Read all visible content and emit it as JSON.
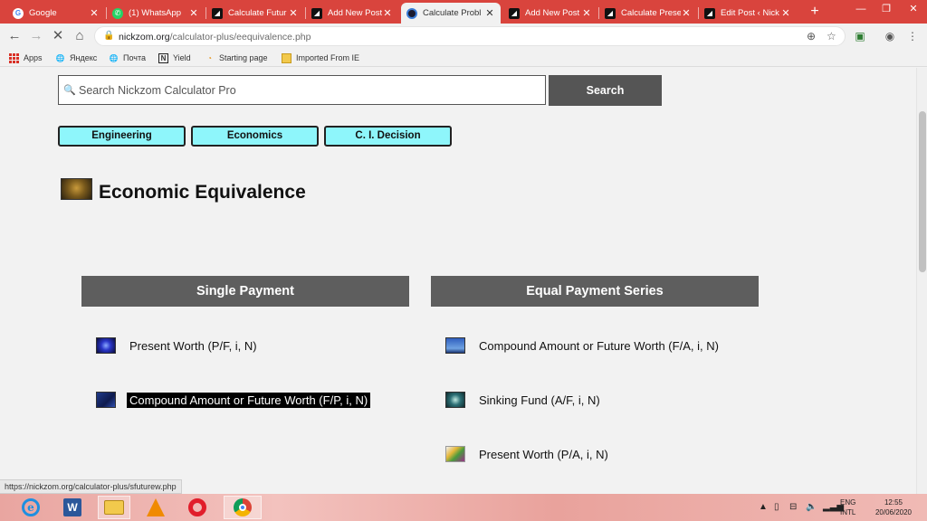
{
  "browser": {
    "tabs": [
      {
        "title": "Google",
        "favicon": "google-icon",
        "active": false
      },
      {
        "title": "(1) WhatsApp",
        "favicon": "whatsapp-icon",
        "active": false
      },
      {
        "title": "Calculate Futur",
        "favicon": "nickzom-icon",
        "active": false
      },
      {
        "title": "Add New Post",
        "favicon": "nickzom-icon",
        "active": false
      },
      {
        "title": "Calculate Probl",
        "favicon": "calculator-pro-icon",
        "active": true
      },
      {
        "title": "Add New Post",
        "favicon": "nickzom-icon",
        "active": false
      },
      {
        "title": "Calculate Prese",
        "favicon": "nickzom-icon",
        "active": false
      },
      {
        "title": "Edit Post ‹ Nick",
        "favicon": "nickzom-icon",
        "active": false
      }
    ],
    "url_host": "nickzom.org",
    "url_path": "/calculator-plus/eequivalence.php",
    "bookmarks": [
      {
        "label": "Apps",
        "icon": "apps-grid-icon"
      },
      {
        "label": "Яндекс",
        "icon": "globe-icon"
      },
      {
        "label": "Почта",
        "icon": "globe-icon"
      },
      {
        "label": "Yield",
        "icon": "notion-icon"
      },
      {
        "label": "Starting page",
        "icon": "starting-page-icon"
      },
      {
        "label": "Imported From IE",
        "icon": "folder-icon"
      }
    ],
    "status_url": "https://nickzom.org/calculator-plus/sfuturew.php"
  },
  "page": {
    "search": {
      "placeholder": "Search Nickzom Calculator Pro",
      "value": "",
      "button_label": "Search"
    },
    "categories": [
      "Engineering",
      "Economics",
      "C. I. Decision"
    ],
    "title": "Economic Equivalence",
    "sections": [
      {
        "heading": "Single Payment",
        "items": [
          {
            "label": "Present Worth (P/F, i, N)",
            "thumb": "th-blue",
            "highlighted": false
          },
          {
            "label": "Compound Amount or Future Worth (F/P, i, N)",
            "thumb": "th-navy",
            "highlighted": true
          }
        ]
      },
      {
        "heading": "Equal Payment Series",
        "items": [
          {
            "label": "Compound Amount or Future Worth (F/A, i, N)",
            "thumb": "th-sky",
            "highlighted": false
          },
          {
            "label": "Sinking Fund (A/F, i, N)",
            "thumb": "th-teal",
            "highlighted": false
          },
          {
            "label": "Present Worth (P/A, i, N)",
            "thumb": "th-art",
            "highlighted": false
          }
        ]
      }
    ]
  },
  "taskbar": {
    "apps": [
      "internet-explorer-icon",
      "word-icon",
      "file-explorer-icon",
      "vlc-icon",
      "opera-icon",
      "chrome-icon"
    ],
    "lang_line1": "ENG",
    "lang_line2": "INTL",
    "time": "12:55",
    "date": "20/06/2020"
  }
}
